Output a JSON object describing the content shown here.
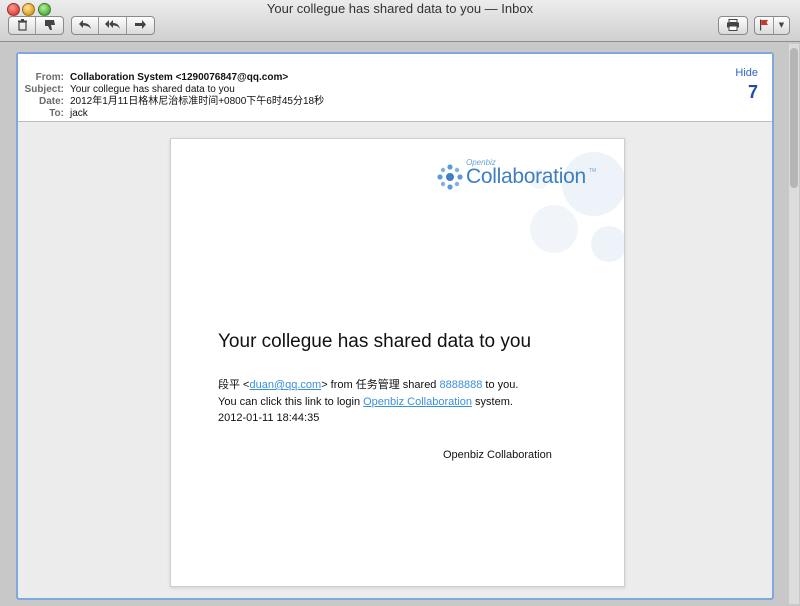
{
  "window": {
    "title": "Your collegue has shared data to you — Inbox"
  },
  "toolbar": {
    "delete_icon": "trash-icon",
    "junk_icon": "thumbs-down-icon",
    "reply_icon": "reply-icon",
    "reply_all_icon": "reply-all-icon",
    "forward_icon": "forward-icon",
    "print_icon": "printer-icon",
    "flag_icon": "flag-icon",
    "flag_color": "#d0342c"
  },
  "header": {
    "from_label": "From:",
    "from_value": "Collaboration System <1290076847@qq.com>",
    "subject_label": "Subject:",
    "subject_value": "Your collegue has shared data to you",
    "date_label": "Date:",
    "date_value": "2012年1月11日格林尼治标准时间+0800下午6时45分18秒",
    "to_label": "To:",
    "to_value": "jack",
    "hide_link": "Hide",
    "message_count": "7"
  },
  "email": {
    "logo_small": "Openbiz",
    "logo_main": "Collaboration",
    "logo_tm": "TM",
    "headline": "Your collegue has shared data to you",
    "line1_prefix": "段平 <",
    "line1_email": "duan@qq.com",
    "line1_mid": "> from 任务管理 shared ",
    "line1_data": "8888888",
    "line1_suffix": " to you.",
    "line2_prefix": "You can click this link to login ",
    "line2_link": "Openbiz Collaboration",
    "line2_suffix": " system.",
    "timestamp": "2012-01-11 18:44:35",
    "signature": "Openbiz Collaboration"
  },
  "colors": {
    "accent": "#3f7fc2",
    "link": "#3b8fe0",
    "selection_border": "#7fa8dd"
  }
}
